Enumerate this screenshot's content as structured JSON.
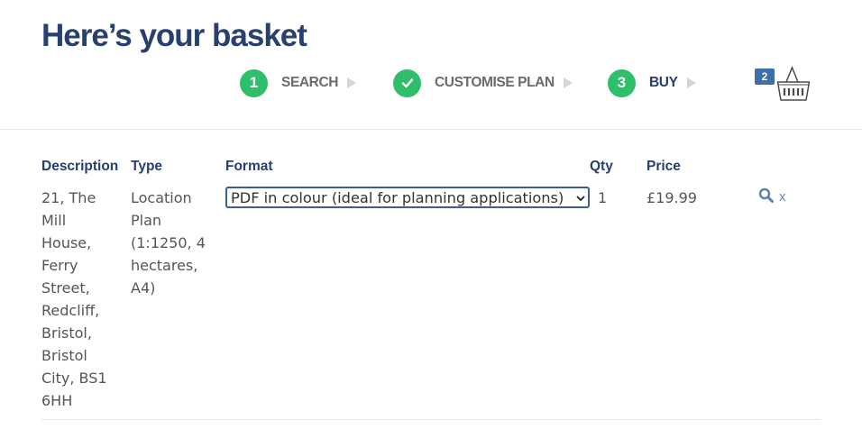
{
  "page": {
    "title": "Here’s your basket"
  },
  "steps": [
    {
      "number": "1",
      "label": "SEARCH",
      "state": "numbered"
    },
    {
      "number": "",
      "label": "CUSTOMISE PLAN",
      "state": "completed",
      "icon": "checkmark-icon"
    },
    {
      "number": "3",
      "label": "BUY",
      "state": "active"
    }
  ],
  "basket": {
    "count": "2",
    "icon": "basket-icon"
  },
  "table": {
    "headers": {
      "description": "Description",
      "type": "Type",
      "format": "Format",
      "qty": "Qty",
      "price": "Price"
    },
    "rows": [
      {
        "description": "21, The Mill House, Ferry Street, Redcliff, Bristol, Bristol City, BS1 6HH",
        "type": "Location Plan (1:1250, 4 hectares, A4)",
        "format": "PDF in colour (ideal for planning applications)",
        "qty": "1",
        "price": "£19.99",
        "actions": {
          "view_icon": "search-icon",
          "remove_label": "x"
        }
      }
    ]
  },
  "colors": {
    "heading": "#27406e",
    "step_circle": "#2fbf6a",
    "badge": "#3d6fa8",
    "select_border": "#3b5f96"
  }
}
